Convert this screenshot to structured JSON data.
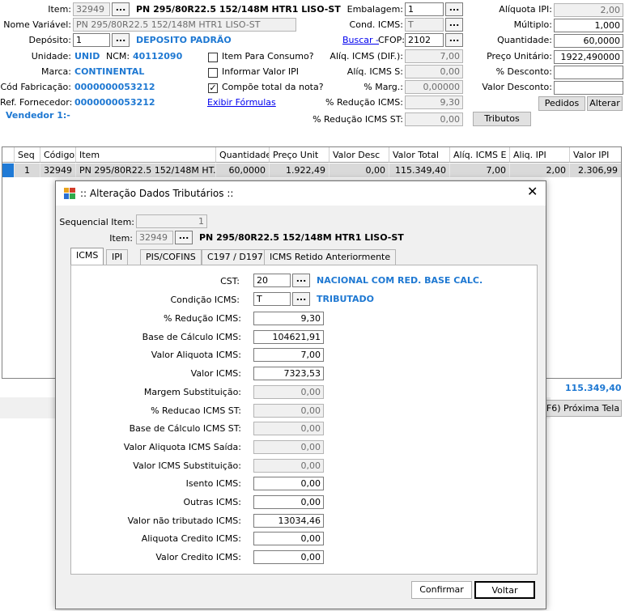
{
  "header": {
    "item_label": "Item:",
    "item_code": "32949",
    "item_desc": "PN 295/80R22.5 152/148M HTR1 LISO-ST",
    "nome_variavel_label": "Nome Variável:",
    "nome_variavel": "PN 295/80R22.5 152/148M HTR1 LISO-ST",
    "deposito_label": "Depósito:",
    "deposito_code": "1",
    "deposito_name": "DEPOSITO PADRÃO",
    "unidade_label": "Unidade:",
    "unidade": "UNID",
    "ncm_label": "NCM:",
    "ncm": "40112090",
    "marca_label": "Marca:",
    "marca": "CONTINENTAL",
    "cod_fab_label": "Cód Fabricação:",
    "cod_fab": "0000000053212",
    "ref_forn_label": "Ref. Fornecedor:",
    "ref_forn": "0000000053212",
    "vendedor": "Vendedor 1:-",
    "chk_consumo": "Item Para Consumo?",
    "chk_ipi": "Informar Valor IPI",
    "chk_total": "Compõe total da nota?",
    "exibir_formulas": "Exibir Fórmulas",
    "embalagem_label": "Embalagem:",
    "embalagem": "1",
    "cond_icms_label": "Cond. ICMS:",
    "cond_icms": "T",
    "buscar": "Buscar -",
    "cfop_label": "CFOP:",
    "cfop": "2102",
    "aliq_icms_dif_label": "Alíq. ICMS (DIF.):",
    "aliq_icms_dif": "7,00",
    "aliq_icms_s_label": "Alíq. ICMS S:",
    "aliq_icms_s": "0,00",
    "marg_label": "% Marg.:",
    "marg": "0,00000",
    "red_icms_label": "% Redução ICMS:",
    "red_icms": "9,30",
    "red_icms_st_label": "% Redução ICMS ST:",
    "red_icms_st": "0,00",
    "tributos_btn": "Tributos",
    "aliq_ipi_label": "Alíquota IPI:",
    "aliq_ipi": "2,00",
    "multiplo_label": "Múltiplo:",
    "multiplo": "1,000",
    "quantidade_label": "Quantidade:",
    "quantidade": "60,0000",
    "preco_unit_label": "Preço Unitário:",
    "preco_unit": "1922,490000",
    "desconto_pct_label": "% Desconto:",
    "desconto_pct": "",
    "valor_desconto_label": "Valor Desconto:",
    "valor_desconto": "",
    "pedidos_btn": "Pedidos",
    "alterar_btn": "Alterar"
  },
  "grid": {
    "columns": [
      "Seq",
      "Código",
      "Item",
      "Quantidade",
      "Preço Unit",
      "Valor Desc",
      "Valor Total",
      "Alíq. ICMS E",
      "Aliq. IPI",
      "Valor IPI"
    ],
    "rows": [
      [
        "1",
        "32949",
        "PN 295/80R22.5 152/148M HT...",
        "60,0000",
        "1.922,49",
        "0,00",
        "115.349,40",
        "7,00",
        "2,00",
        "2.306,99"
      ]
    ]
  },
  "footer": {
    "total": "115.349,40",
    "proxima_tela": "F6) Próxima Tela"
  },
  "dialog": {
    "title": ":: Alteração Dados Tributários ::",
    "sequencial_label": "Sequencial Item:",
    "sequencial": "1",
    "item_label": "Item:",
    "item_code": "32949",
    "item_desc": "PN 295/80R22.5 152/148M HTR1 LISO-ST",
    "tabs": [
      "ICMS",
      "IPI",
      "PIS/COFINS",
      "C197 / D197",
      "ICMS Retido Anteriormente"
    ],
    "cst_label": "CST:",
    "cst": "20",
    "cst_desc": "NACIONAL COM RED. BASE CALC.",
    "cond_label": "Condição ICMS:",
    "cond": "T",
    "cond_desc": "TRIBUTADO",
    "fields": [
      {
        "label": "% Redução ICMS:",
        "value": "9,30",
        "enabled": true
      },
      {
        "label": "Base de Cálculo ICMS:",
        "value": "104621,91",
        "enabled": true
      },
      {
        "label": "Valor Aliquota ICMS:",
        "value": "7,00",
        "enabled": true
      },
      {
        "label": "Valor ICMS:",
        "value": "7323,53",
        "enabled": true
      },
      {
        "label": "Margem Substituição:",
        "value": "0,00",
        "enabled": false
      },
      {
        "label": "% Reducao ICMS ST:",
        "value": "0,00",
        "enabled": false
      },
      {
        "label": "Base de Cálculo ICMS ST:",
        "value": "0,00",
        "enabled": false
      },
      {
        "label": "Valor Aliquota ICMS Saída:",
        "value": "0,00",
        "enabled": false
      },
      {
        "label": "Valor ICMS Substituição:",
        "value": "0,00",
        "enabled": false
      },
      {
        "label": "Isento ICMS:",
        "value": "0,00",
        "enabled": true
      },
      {
        "label": "Outras ICMS:",
        "value": "0,00",
        "enabled": true
      },
      {
        "label": "Valor não tributado ICMS:",
        "value": "13034,46",
        "enabled": true
      },
      {
        "label": "Aliquota Credito ICMS:",
        "value": "0,00",
        "enabled": true
      },
      {
        "label": "Valor Credito ICMS:",
        "value": "0,00",
        "enabled": true
      }
    ],
    "confirmar_btn": "Confirmar",
    "voltar_btn": "Voltar"
  }
}
